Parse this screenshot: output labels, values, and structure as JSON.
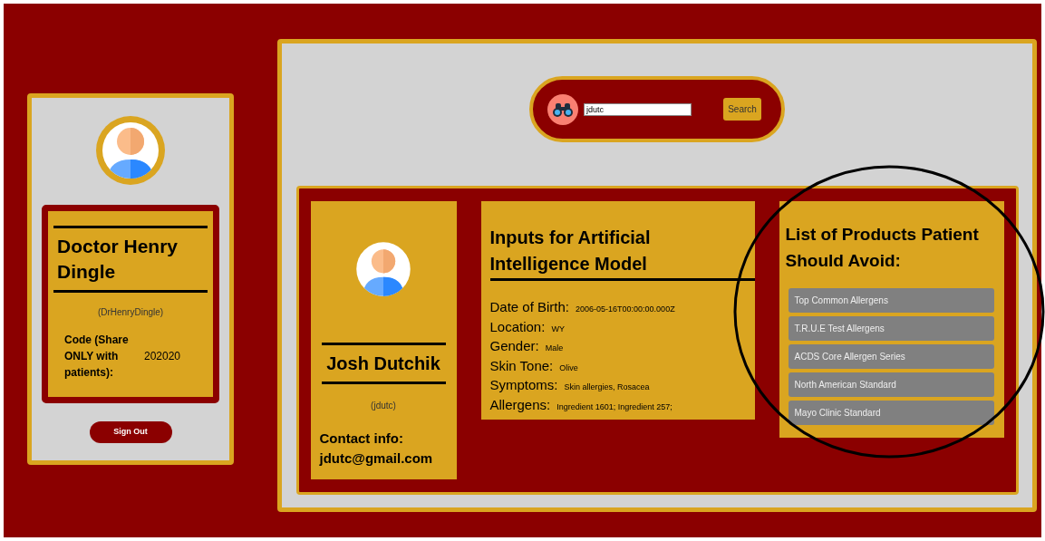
{
  "doctor": {
    "name": "Doctor Henry Dingle",
    "username": "(DrHenryDingle)",
    "code_label": "Code (Share ONLY with patients):",
    "code": "202020",
    "sign_out": "Sign Out"
  },
  "search": {
    "value": "jdutc",
    "button": "Search"
  },
  "patient": {
    "name": "Josh Dutchik",
    "username": "(jdutc)",
    "contact_label": "Contact info:",
    "email": "jdutc@gmail.com"
  },
  "inputs": {
    "title": "Inputs for Artificial Intelligence Model",
    "fields": [
      {
        "label": "Date of Birth:",
        "value": "2006-05-16T00:00:00.000Z"
      },
      {
        "label": "Location:",
        "value": "WY"
      },
      {
        "label": "Gender:",
        "value": "Male"
      },
      {
        "label": "Skin Tone:",
        "value": "Olive"
      },
      {
        "label": "Symptoms:",
        "value": "Skin allergies, Rosacea"
      },
      {
        "label": "Allergens:",
        "value": "Ingredient 1601; Ingredient 257;"
      }
    ]
  },
  "products": {
    "title": "List of Products Patient Should Avoid:",
    "items": [
      "Top Common Allergens",
      "T.R.U.E Test Allergens",
      "ACDS Core Allergen Series",
      "North American Standard",
      "Mayo Clinic Standard"
    ]
  }
}
